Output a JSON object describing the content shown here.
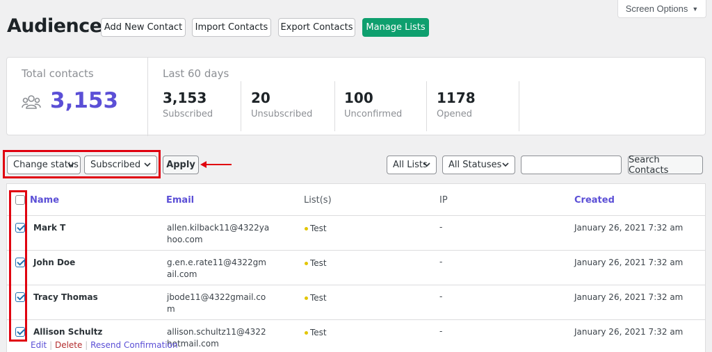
{
  "header": {
    "screen_options": "Screen Options",
    "title": "Audience",
    "buttons": {
      "add_new": "Add New Contact",
      "import": "Import Contacts",
      "export": "Export Contacts",
      "manage_lists": "Manage Lists"
    }
  },
  "stats": {
    "total_label": "Total contacts",
    "total_value": "3,153",
    "period_label": "Last 60 days",
    "items": [
      {
        "value": "3,153",
        "label": "Subscribed"
      },
      {
        "value": "20",
        "label": "Unsubscribed"
      },
      {
        "value": "100",
        "label": "Unconfirmed"
      },
      {
        "value": "1178",
        "label": "Opened"
      }
    ]
  },
  "toolbar": {
    "bulk_action": "Change status",
    "status_value": "Subscribed",
    "apply": "Apply",
    "list_filter": "All Lists",
    "status_filter": "All Statuses",
    "search_value": "",
    "search_button": "Search Contacts"
  },
  "table": {
    "columns": {
      "name": "Name",
      "email": "Email",
      "lists": "List(s)",
      "ip": "IP",
      "created": "Created"
    },
    "rows": [
      {
        "name": "Mark T",
        "email": "allen.kilback11@4322yahoo.com",
        "list": "Test",
        "ip": "-",
        "created": "January 26, 2021 7:32 am",
        "checked": true
      },
      {
        "name": "John Doe",
        "email": "g.en.e.rate11@4322gmail.com",
        "list": "Test",
        "ip": "-",
        "created": "January 26, 2021 7:32 am",
        "checked": true
      },
      {
        "name": "Tracy Thomas",
        "email": "jbode11@4322gmail.com",
        "list": "Test",
        "ip": "-",
        "created": "January 26, 2021 7:32 am",
        "checked": true
      },
      {
        "name": "Allison Schultz",
        "email": "allison.schultz11@4322hotmail.com",
        "list": "Test",
        "ip": "-",
        "created": "January 26, 2021 7:32 am",
        "checked": true
      }
    ],
    "row_actions": {
      "edit": "Edit",
      "delete": "Delete",
      "resend": "Resend Confirmation",
      "sep": "|"
    }
  },
  "colors": {
    "accent": "#5b4fd6",
    "primary_button": "#0e9f6e",
    "highlight": "#e0000f",
    "list_dot": "#e2c500"
  },
  "icons": {
    "total": "users-group-icon",
    "dropdown": "chevron-down-icon",
    "annotation": "arrow-left-icon"
  }
}
